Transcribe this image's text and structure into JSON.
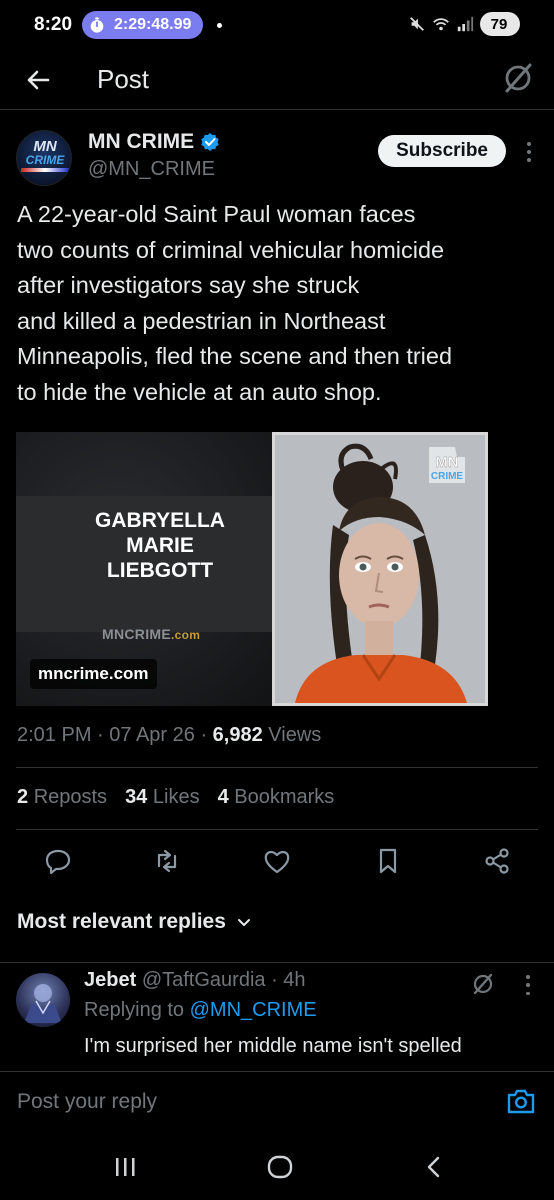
{
  "status_bar": {
    "time": "8:20",
    "timer": "2:29:48.99",
    "network": "6",
    "battery": "79"
  },
  "header": {
    "title": "Post"
  },
  "post": {
    "author_name": "MN CRIME",
    "author_handle": "@MN_CRIME",
    "subscribe_label": "Subscribe",
    "text": "A 22-year-old Saint Paul woman faces\ntwo counts of criminal vehicular homicide\nafter investigators say she struck\nand killed a pedestrian in Northeast\nMinneapolis, fled the scene and then tried\nto hide the vehicle at an auto shop.",
    "media": {
      "name_lines": [
        "GABRYELLA",
        "MARIE",
        "LIEBGOTT"
      ],
      "watermark": "MNCRIME",
      "watermark_suffix": ".com",
      "url_chip": "mncrime.com",
      "logo_top": "MN",
      "logo_bottom": "CRIME"
    },
    "time": "2:01 PM",
    "date": "07 Apr 26",
    "views_count": "6,982",
    "views_label": "Views",
    "reposts_count": "2",
    "reposts_label": "Reposts",
    "likes_count": "34",
    "likes_label": "Likes",
    "bookmarks_count": "4",
    "bookmarks_label": "Bookmarks"
  },
  "replies": {
    "header": "Most relevant replies",
    "items": [
      {
        "name": "Jebet",
        "handle": "@TaftGaurdia",
        "age": "4h",
        "replying_prefix": "Replying to",
        "replying_to": "@MN_CRIME",
        "text": "I'm surprised her middle name isn't spelled"
      }
    ]
  },
  "composer": {
    "placeholder": "Post your reply"
  },
  "icons": {
    "back": "arrow-left-icon",
    "grok": "grok-icon",
    "reply": "reply-icon",
    "repost": "repost-icon",
    "like": "heart-icon",
    "bookmark": "bookmark-icon",
    "share": "share-icon",
    "camera": "camera-icon"
  },
  "colors": {
    "background": "#000000",
    "text": "#e7e9ea",
    "muted": "#71767b",
    "accent": "#1d9bf0",
    "timer_pill": "#7b7cf0"
  }
}
